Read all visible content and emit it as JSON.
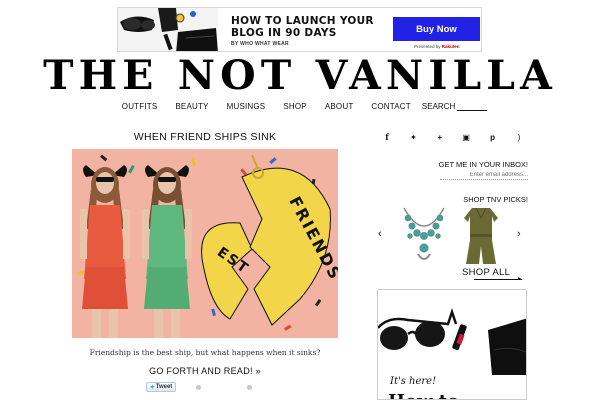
{
  "banner": {
    "headline": "HOW TO LAUNCH YOUR BLOG IN 90 DAYS",
    "byline": "BY WHO WHAT WEAR",
    "button_label": "Buy Now",
    "presented_by": "Presented by",
    "sponsor": "Rakuten",
    "colors": {
      "button": "#2222e6"
    }
  },
  "site": {
    "logo": "THE NOT VANILLA"
  },
  "nav": {
    "items": [
      {
        "label": "OUTFITS"
      },
      {
        "label": "BEAUTY"
      },
      {
        "label": "MUSINGS"
      },
      {
        "label": "SHOP"
      },
      {
        "label": "ABOUT"
      },
      {
        "label": "CONTACT"
      }
    ],
    "search_label": "SEARCH"
  },
  "post": {
    "title": "WHEN FRIEND SHIPS SINK",
    "image_text_1": "FRIENDS",
    "image_text_2": "EST",
    "caption": "Friendship is the best ship, but what happens when it sinks?",
    "read_more": "GO FORTH AND READ! »",
    "tweet_label": "Tweet"
  },
  "sidebar": {
    "social": [
      {
        "icon": "facebook-icon",
        "glyph": "f"
      },
      {
        "icon": "twitter-icon",
        "glyph": "✦"
      },
      {
        "icon": "plus-icon",
        "glyph": "+"
      },
      {
        "icon": "instagram-icon",
        "glyph": "▣"
      },
      {
        "icon": "pinterest-icon",
        "glyph": "p"
      },
      {
        "icon": "rss-icon",
        "glyph": ")"
      }
    ],
    "inbox_title": "GET ME IN YOUR INBOX!",
    "inbox_placeholder": "Enter email address...",
    "shop_title": "SHOP TNV PICKS!",
    "prev_glyph": "‹",
    "next_glyph": "›",
    "shop_all": "SHOP ALL",
    "ad_tagline": "It's here!",
    "ad_big_text": "How to"
  }
}
